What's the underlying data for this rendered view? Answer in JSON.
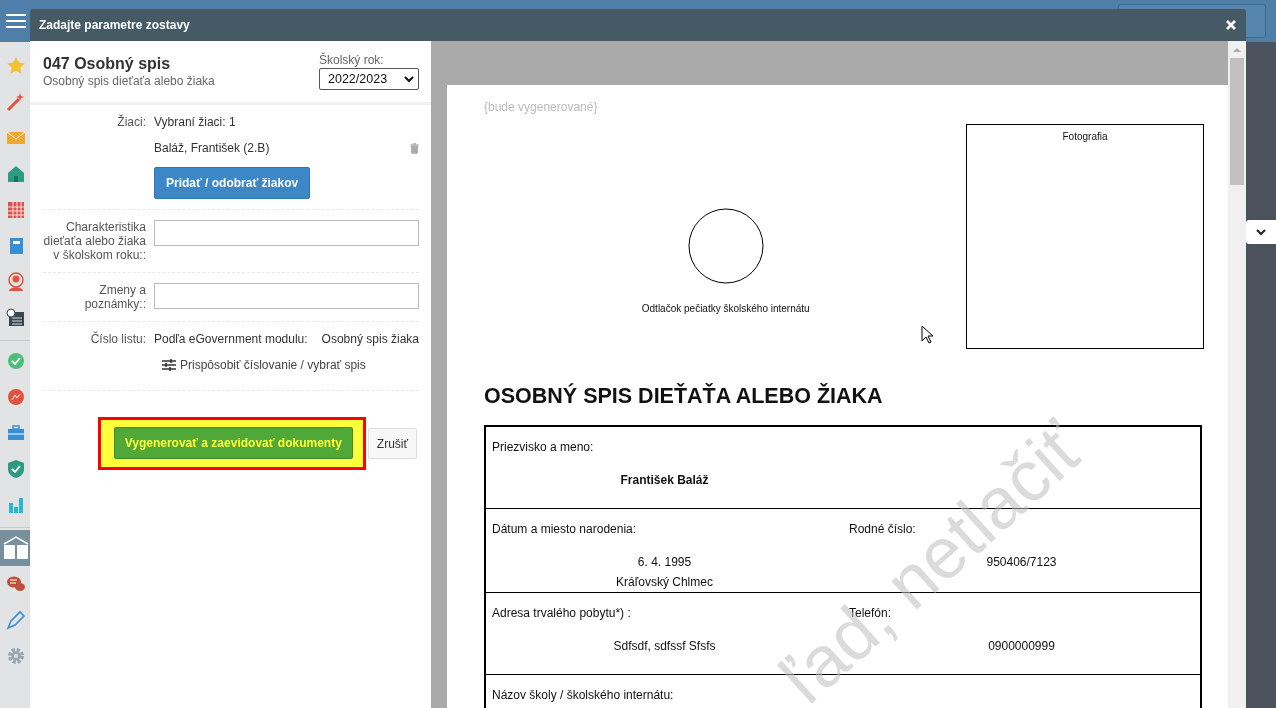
{
  "sidebar": {
    "items": [
      {
        "selected": false
      },
      {
        "selected": false
      },
      {
        "selected": false
      },
      {
        "selected": false
      },
      {
        "selected": false
      },
      {
        "selected": false
      },
      {
        "selected": false
      },
      {
        "selected": false
      },
      {
        "selected": false
      },
      {
        "selected": false
      },
      {
        "selected": false
      },
      {
        "selected": false
      },
      {
        "selected": false
      },
      {
        "selected": true
      },
      {
        "selected": false
      },
      {
        "selected": false
      },
      {
        "selected": false
      }
    ]
  },
  "dialog": {
    "title": "Zadajte parametre zostavy"
  },
  "report": {
    "title": "047 Osobný spis",
    "subtitle": "Osobný spis dieťaťa alebo žiaka",
    "year_label": "Školský rok:",
    "year_value": "2022/2023"
  },
  "students": {
    "label": "Žiaci:",
    "summary": "Vybraní žiaci: 1",
    "items": [
      "Baláž, František (2.B)"
    ],
    "button": "Pridať / odobrať žiakov"
  },
  "fields": [
    {
      "label": "Charakteristika dieťaťa alebo žiaka v školskom roku::"
    },
    {
      "label": "Zmeny a poznámky::"
    }
  ],
  "sheet_number": {
    "label": "Číslo listu:",
    "value": "Podľa eGovernment modulu:",
    "module": "Osobný spis žiaka",
    "link": "Prispôsobiť číslovanie / vybrať spis"
  },
  "actions": {
    "generate": "Vygenerovať a zaevidovať dokumenty",
    "highlighted": true,
    "cancel": "Zrušiť"
  },
  "preview": {
    "pending_note": "{bude vygenerované}",
    "photo_label": "Fotografia",
    "stamp_label": "Odtlačok pečiatky školského internátu",
    "heading": "OSOBNÝ SPIS DIEŤAŤA ALEBO ŽIAKA",
    "watermark": "ľad, netlačiť",
    "rows": [
      {
        "cells": [
          {
            "label": "Priezvisko a meno:",
            "value": [
              "František Baláž"
            ],
            "bold": true
          }
        ]
      },
      {
        "cells": [
          {
            "label": "Dátum a miesto narodenia:",
            "value": [
              "6. 4. 1995",
              "Kráľovský Chlmec"
            ],
            "bold": false
          },
          {
            "label": "Rodné číslo:",
            "value": [
              "950406/7123"
            ],
            "bold": false
          }
        ]
      },
      {
        "cells": [
          {
            "label": "Adresa trvalého pobytu*) :",
            "value": [
              "Sdfsdf, sdfssf Sfsfs"
            ],
            "bold": false
          },
          {
            "label": "Telefón:",
            "value": [
              "0900000999"
            ],
            "bold": false
          }
        ]
      },
      {
        "cells": [
          {
            "label": "Názov školy / školského internátu:"
          }
        ]
      }
    ]
  }
}
